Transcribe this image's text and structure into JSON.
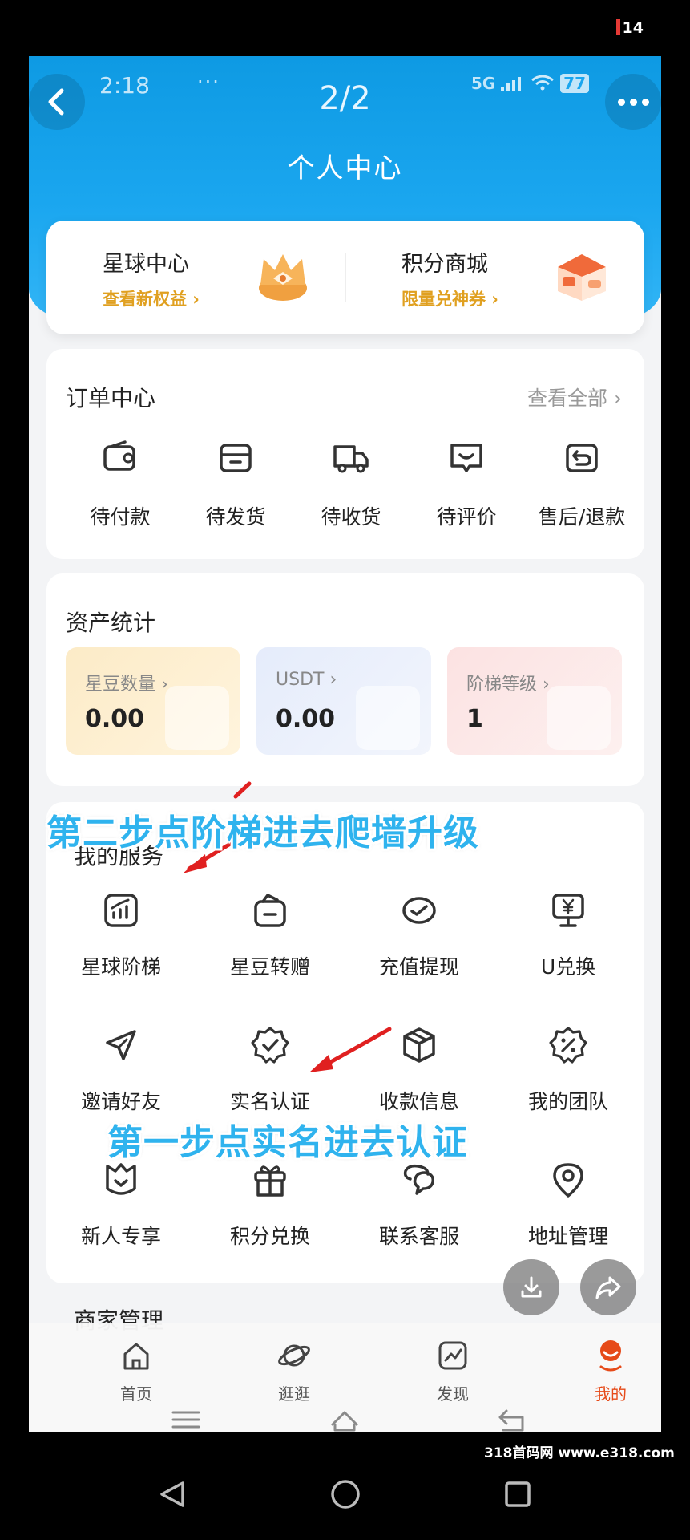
{
  "outer_status": {
    "badge": "14"
  },
  "status_bar": {
    "time": "2:18",
    "dots": "···",
    "network": "5G",
    "battery": "77"
  },
  "header": {
    "page_counter": "2/2",
    "title": "个人中心"
  },
  "promos": [
    {
      "title": "星球中心",
      "subtitle": "查看新权益 ›"
    },
    {
      "title": "积分商城",
      "subtitle": "限量兑神券 ›"
    }
  ],
  "orders": {
    "title": "订单中心",
    "view_all": "查看全部 ›",
    "items": [
      {
        "label": "待付款",
        "icon": "wallet-icon"
      },
      {
        "label": "待发货",
        "icon": "box-icon"
      },
      {
        "label": "待收货",
        "icon": "truck-icon"
      },
      {
        "label": "待评价",
        "icon": "comment-icon"
      },
      {
        "label": "售后/退款",
        "icon": "refund-icon"
      }
    ]
  },
  "assets": {
    "title": "资产统计",
    "items": [
      {
        "label": "星豆数量 ›",
        "value": "0.00"
      },
      {
        "label": "USDT ›",
        "value": "0.00"
      },
      {
        "label": "阶梯等级 ›",
        "value": "1"
      }
    ]
  },
  "services": {
    "title": "我的服务",
    "items": [
      {
        "label": "星球阶梯",
        "icon": "chart-icon"
      },
      {
        "label": "星豆转赠",
        "icon": "bag-icon"
      },
      {
        "label": "充值提现",
        "icon": "check-circle-icon"
      },
      {
        "label": "U兑换",
        "icon": "yen-monitor-icon"
      },
      {
        "label": "邀请好友",
        "icon": "send-icon"
      },
      {
        "label": "实名认证",
        "icon": "verified-badge-icon"
      },
      {
        "label": "收款信息",
        "icon": "package-icon"
      },
      {
        "label": "我的团队",
        "icon": "percent-badge-icon"
      },
      {
        "label": "新人专享",
        "icon": "shield-heart-icon"
      },
      {
        "label": "积分兑换",
        "icon": "gift-icon"
      },
      {
        "label": "联系客服",
        "icon": "chat-icon"
      },
      {
        "label": "地址管理",
        "icon": "location-icon"
      }
    ]
  },
  "merchant": {
    "title": "商家管理"
  },
  "bottom_nav": [
    {
      "label": "首页",
      "icon": "home-icon"
    },
    {
      "label": "逛逛",
      "icon": "planet-icon"
    },
    {
      "label": "发现",
      "icon": "trend-icon"
    },
    {
      "label": "我的",
      "icon": "avatar-icon"
    }
  ],
  "annotations": {
    "step2": "第二步点阶梯进去爬墙升级",
    "step1": "第一步点实名进去认证"
  },
  "watermark": "318首码网 www.e318.com",
  "colors": {
    "primary": "#1aa6ef",
    "accent_gold": "#e0a020",
    "active_tab": "#e64a19",
    "annotation_arrow": "#e02020"
  }
}
